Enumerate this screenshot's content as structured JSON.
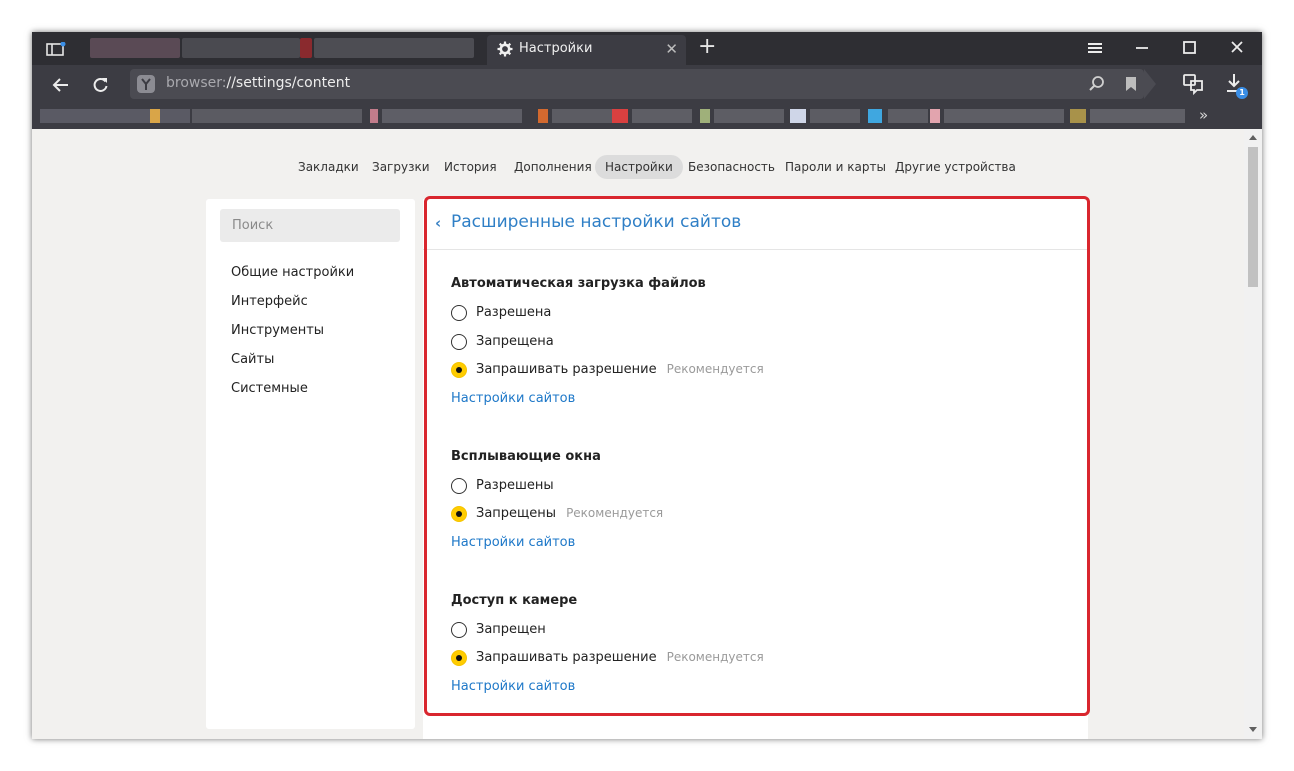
{
  "tab": {
    "title": "Настройки",
    "close": "✕",
    "new_tab": "+"
  },
  "address": {
    "scheme": "browser:",
    "path": "//settings/content"
  },
  "bookmarks_more": "»",
  "download_count": "1",
  "top_nav": [
    {
      "label": "Закладки",
      "active": false
    },
    {
      "label": "Загрузки",
      "active": false
    },
    {
      "label": "История",
      "active": false
    },
    {
      "label": "Дополнения",
      "active": false
    },
    {
      "label": "Настройки",
      "active": true
    },
    {
      "label": "Безопасность",
      "active": false
    },
    {
      "label": "Пароли и карты",
      "active": false
    },
    {
      "label": "Другие устройства",
      "active": false
    }
  ],
  "sidebar": {
    "search_placeholder": "Поиск",
    "items": [
      "Общие настройки",
      "Интерфейс",
      "Инструменты",
      "Сайты",
      "Системные"
    ]
  },
  "main": {
    "title": "Расширенные настройки сайтов",
    "sections": [
      {
        "title": "Автоматическая загрузка файлов",
        "options": [
          {
            "label": "Разрешена",
            "checked": false,
            "hint": ""
          },
          {
            "label": "Запрещена",
            "checked": false,
            "hint": ""
          },
          {
            "label": "Запрашивать разрешение",
            "checked": true,
            "hint": "Рекомендуется"
          }
        ],
        "link": "Настройки сайтов"
      },
      {
        "title": "Всплывающие окна",
        "options": [
          {
            "label": "Разрешены",
            "checked": false,
            "hint": ""
          },
          {
            "label": "Запрещены",
            "checked": true,
            "hint": "Рекомендуется"
          }
        ],
        "link": "Настройки сайтов"
      },
      {
        "title": "Доступ к камере",
        "options": [
          {
            "label": "Запрещен",
            "checked": false,
            "hint": ""
          },
          {
            "label": "Запрашивать разрешение",
            "checked": true,
            "hint": "Рекомендуется"
          }
        ],
        "link": "Настройки сайтов"
      }
    ]
  },
  "colors": {
    "tabbar": "#2e2e33",
    "toolbar": "#3c3c43",
    "link": "#1e78c8",
    "title": "#2f7fc6",
    "radio_checked": "#ffcc00",
    "highlight_frame": "#d9262e"
  }
}
